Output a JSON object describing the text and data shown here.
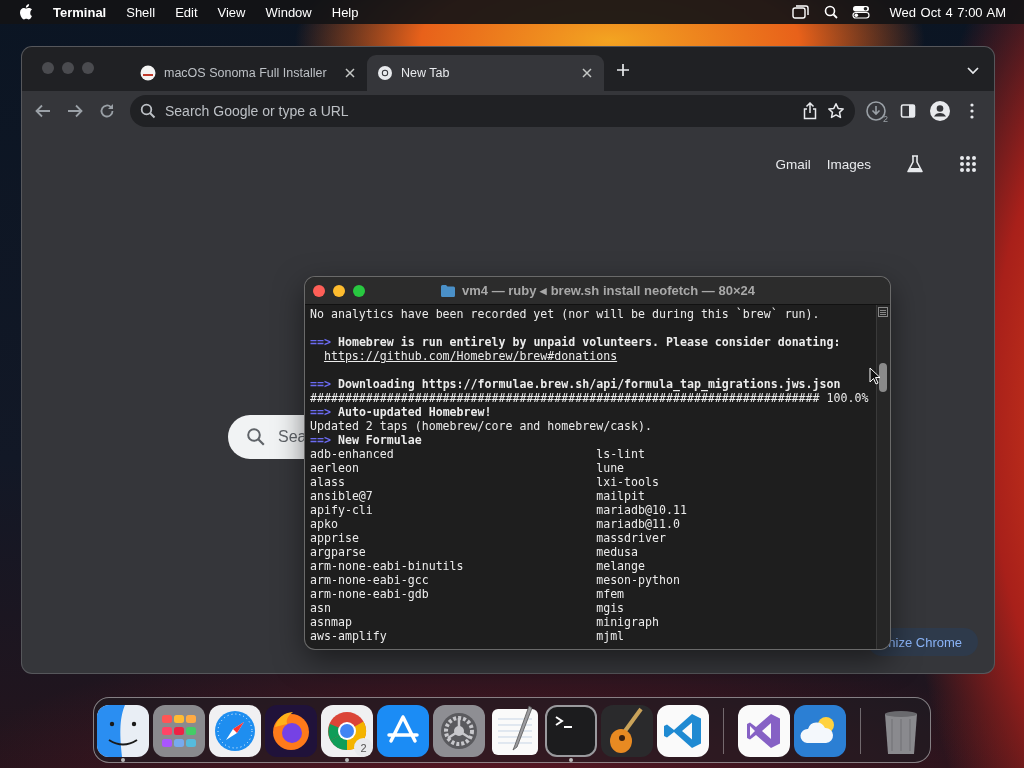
{
  "menu_bar": {
    "app_name": "Terminal",
    "menus": [
      "Shell",
      "Edit",
      "View",
      "Window",
      "Help"
    ],
    "clock": "Wed Oct 4 7:00 AM"
  },
  "browser": {
    "tabs": [
      {
        "title": "macOS Sonoma Full Installer",
        "selected": false
      },
      {
        "title": "New Tab",
        "selected": true
      }
    ],
    "omnibox": {
      "placeholder": "Search Google or type a URL"
    },
    "downloads_badge": "2",
    "header_links": [
      "Gmail",
      "Images"
    ],
    "search_box": {
      "placeholder": "Sea"
    },
    "customize_button": "nize Chrome"
  },
  "terminal": {
    "title": "vm4 — ruby ◂ brew.sh install neofetch — 80×24",
    "lines": [
      {
        "kind": "text",
        "text": "No analytics have been recorded yet (nor will be during this `brew` run)."
      },
      {
        "kind": "blank"
      },
      {
        "kind": "heading",
        "marker": "==>",
        "text": "Homebrew is run entirely by unpaid volunteers. Please consider donating:"
      },
      {
        "kind": "link",
        "text": "https://github.com/Homebrew/brew#donations"
      },
      {
        "kind": "blank"
      },
      {
        "kind": "heading",
        "marker": "==>",
        "text": "Downloading https://formulae.brew.sh/api/formula_tap_migrations.jws.json"
      },
      {
        "kind": "text",
        "text": "######################################################################### 100.0%"
      },
      {
        "kind": "heading",
        "marker": "==>",
        "text": "Auto-updated Homebrew!"
      },
      {
        "kind": "text",
        "text": "Updated 2 taps (homebrew/core and homebrew/cask)."
      },
      {
        "kind": "heading",
        "marker": "==>",
        "text": "New Formulae"
      }
    ],
    "formulae": [
      [
        "adb-enhanced",
        "ls-lint"
      ],
      [
        "aerleon",
        "lune"
      ],
      [
        "alass",
        "lxi-tools"
      ],
      [
        "ansible@7",
        "mailpit"
      ],
      [
        "apify-cli",
        "mariadb@10.11"
      ],
      [
        "apko",
        "mariadb@11.0"
      ],
      [
        "apprise",
        "massdriver"
      ],
      [
        "argparse",
        "medusa"
      ],
      [
        "arm-none-eabi-binutils",
        "melange"
      ],
      [
        "arm-none-eabi-gcc",
        "meson-python"
      ],
      [
        "arm-none-eabi-gdb",
        "mfem"
      ],
      [
        "asn",
        "mgis"
      ],
      [
        "asnmap",
        "minigraph"
      ],
      [
        "aws-amplify",
        "mjml"
      ]
    ]
  },
  "dock": {
    "items": [
      {
        "kind": "finder",
        "running": true
      },
      {
        "kind": "launchpad",
        "running": false
      },
      {
        "kind": "safari",
        "running": false
      },
      {
        "kind": "firefox",
        "running": false
      },
      {
        "kind": "chrome",
        "running": true,
        "badge": "2"
      },
      {
        "kind": "appstore",
        "running": false
      },
      {
        "kind": "settings",
        "running": false
      },
      {
        "kind": "textedit",
        "running": false
      },
      {
        "kind": "terminal",
        "running": true
      },
      {
        "kind": "garageband",
        "running": false
      },
      {
        "kind": "vscode",
        "running": false
      },
      {
        "kind": "separator"
      },
      {
        "kind": "visualstudio",
        "running": false
      },
      {
        "kind": "weather",
        "running": false
      },
      {
        "kind": "separator"
      },
      {
        "kind": "trash",
        "running": false
      }
    ]
  }
}
